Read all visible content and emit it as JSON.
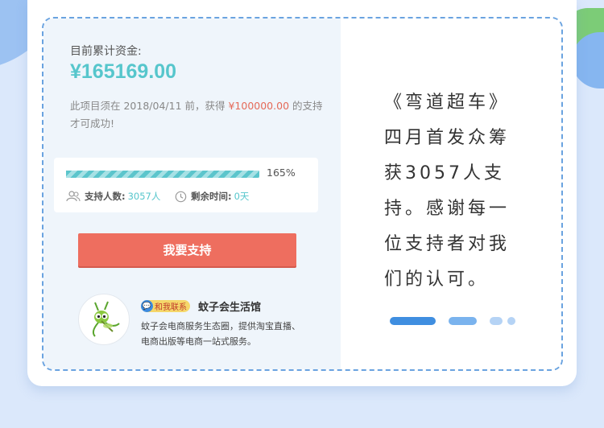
{
  "funding": {
    "label": "目前累计资金:",
    "amount": "¥165169.00"
  },
  "deadline": {
    "prefix": "此项目须在 2018/04/11 前，获得 ",
    "target": "¥100000.00",
    "suffix": " 的支持才可成功!"
  },
  "progress": {
    "percent_text": "165%",
    "percent_value": 165,
    "supporters_label": "支持人数:",
    "supporters_value": "3057人",
    "time_label": "剩余时间:",
    "time_value": "0天"
  },
  "support_button": {
    "label": "我要支持"
  },
  "shop": {
    "contact_label": "和我联系",
    "name": "蚊子会生活馆",
    "description": "蚊子会电商服务生态圈，提供淘宝直播、电商出版等电商一站式服务。"
  },
  "message": {
    "text": "《弯道超车》四月首发众筹获3057人支持。感谢每一位支持者对我们的认可。"
  },
  "colors": {
    "accent_teal": "#56c6cc",
    "accent_red": "#ee6e5f",
    "border_blue": "#6aa3e0"
  }
}
